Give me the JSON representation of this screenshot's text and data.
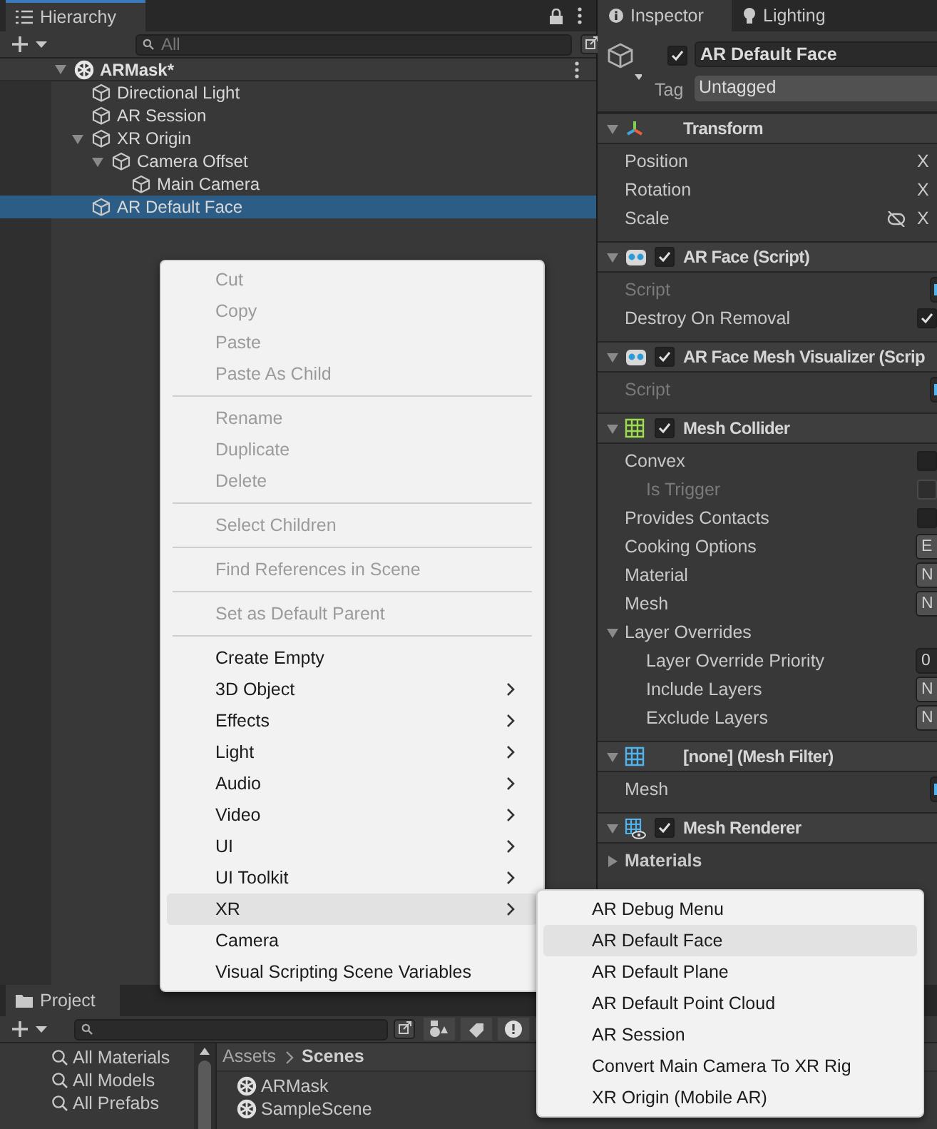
{
  "hierarchy": {
    "tab": "Hierarchy",
    "search_placeholder": "All",
    "scene": {
      "name": "ARMask*",
      "expanded": true,
      "children": [
        {
          "name": "Directional Light",
          "selected": false
        },
        {
          "name": "AR Session",
          "selected": false
        },
        {
          "name": "XR Origin",
          "selected": false,
          "expanded": true,
          "children": [
            {
              "name": "Camera Offset",
              "selected": false,
              "expanded": true,
              "children": [
                {
                  "name": "Main Camera",
                  "selected": false
                }
              ]
            }
          ]
        },
        {
          "name": "AR Default Face",
          "selected": true
        }
      ]
    }
  },
  "context_menu": {
    "groups": [
      [
        {
          "label": "Cut",
          "disabled": true,
          "submenu": false,
          "highlighted": false
        },
        {
          "label": "Copy",
          "disabled": true,
          "submenu": false,
          "highlighted": false
        },
        {
          "label": "Paste",
          "disabled": true,
          "submenu": false,
          "highlighted": false
        },
        {
          "label": "Paste As Child",
          "disabled": true,
          "submenu": false,
          "highlighted": false
        }
      ],
      [
        {
          "label": "Rename",
          "disabled": true,
          "submenu": false,
          "highlighted": false
        },
        {
          "label": "Duplicate",
          "disabled": true,
          "submenu": false,
          "highlighted": false
        },
        {
          "label": "Delete",
          "disabled": true,
          "submenu": false,
          "highlighted": false
        }
      ],
      [
        {
          "label": "Select Children",
          "disabled": true,
          "submenu": false,
          "highlighted": false
        }
      ],
      [
        {
          "label": "Find References in Scene",
          "disabled": true,
          "submenu": false,
          "highlighted": false
        }
      ],
      [
        {
          "label": "Set as Default Parent",
          "disabled": true,
          "submenu": false,
          "highlighted": false
        }
      ],
      [
        {
          "label": "Create Empty",
          "disabled": false,
          "submenu": false,
          "highlighted": false
        },
        {
          "label": "3D Object",
          "disabled": false,
          "submenu": true,
          "highlighted": false
        },
        {
          "label": "Effects",
          "disabled": false,
          "submenu": true,
          "highlighted": false
        },
        {
          "label": "Light",
          "disabled": false,
          "submenu": true,
          "highlighted": false
        },
        {
          "label": "Audio",
          "disabled": false,
          "submenu": true,
          "highlighted": false
        },
        {
          "label": "Video",
          "disabled": false,
          "submenu": true,
          "highlighted": false
        },
        {
          "label": "UI",
          "disabled": false,
          "submenu": true,
          "highlighted": false
        },
        {
          "label": "UI Toolkit",
          "disabled": false,
          "submenu": true,
          "highlighted": false
        },
        {
          "label": "XR",
          "disabled": false,
          "submenu": true,
          "highlighted": true
        },
        {
          "label": "Camera",
          "disabled": false,
          "submenu": false,
          "highlighted": false
        },
        {
          "label": "Visual Scripting Scene Variables",
          "disabled": false,
          "submenu": false,
          "highlighted": false
        }
      ]
    ]
  },
  "submenu": [
    {
      "label": "AR Debug Menu",
      "highlighted": false
    },
    {
      "label": "AR Default Face",
      "highlighted": true
    },
    {
      "label": "AR Default Plane",
      "highlighted": false
    },
    {
      "label": "AR Default Point Cloud",
      "highlighted": false
    },
    {
      "label": "AR Session",
      "highlighted": false
    },
    {
      "label": "Convert Main Camera To XR Rig",
      "highlighted": false
    },
    {
      "label": "XR Origin (Mobile AR)",
      "highlighted": false
    }
  ],
  "inspector": {
    "tabs": [
      {
        "label": "Inspector",
        "selected": true
      },
      {
        "label": "Lighting",
        "selected": false
      }
    ],
    "object": {
      "active": true,
      "name": "AR Default Face",
      "tag_label": "Tag",
      "tag": "Untagged"
    },
    "components": [
      {
        "title": "Transform",
        "kind": "transform",
        "expanded": true,
        "rows": [
          {
            "label": "Position",
            "kind": "axis",
            "value": "X"
          },
          {
            "label": "Rotation",
            "kind": "axis",
            "value": "X"
          },
          {
            "label": "Scale",
            "kind": "axis",
            "value": "X",
            "linked": false
          }
        ]
      },
      {
        "title": "AR Face (Script)",
        "kind": "script",
        "enabled": true,
        "expanded": true,
        "rows": [
          {
            "label": "Script",
            "kind": "object",
            "disabled": true
          },
          {
            "label": "Destroy On Removal",
            "kind": "checkbox",
            "checked": true
          }
        ]
      },
      {
        "title": "AR Face Mesh Visualizer (Scrip",
        "kind": "script",
        "enabled": true,
        "expanded": true,
        "rows": [
          {
            "label": "Script",
            "kind": "object",
            "disabled": true
          }
        ]
      },
      {
        "title": "Mesh Collider",
        "kind": "collider",
        "enabled": true,
        "expanded": true,
        "rows": [
          {
            "label": "Convex",
            "kind": "checkbox",
            "checked": false,
            "children": [
              {
                "label": "Is Trigger",
                "kind": "checkbox",
                "checked": false,
                "disabled": true
              }
            ]
          },
          {
            "label": "Provides Contacts",
            "kind": "checkbox",
            "checked": false
          },
          {
            "label": "Cooking Options",
            "kind": "field",
            "value": "E"
          },
          {
            "label": "Material",
            "kind": "field",
            "value": "N"
          },
          {
            "label": "Mesh",
            "kind": "field",
            "value": "N"
          },
          {
            "label": "Layer Overrides",
            "kind": "foldout",
            "expanded": true,
            "children": [
              {
                "label": "Layer Override Priority",
                "kind": "field",
                "value": "0"
              },
              {
                "label": "Include Layers",
                "kind": "field",
                "value": "N"
              },
              {
                "label": "Exclude Layers",
                "kind": "field",
                "value": "N"
              }
            ]
          }
        ]
      },
      {
        "title": "[none] (Mesh Filter)",
        "kind": "filter",
        "expanded": true,
        "rows": [
          {
            "label": "Mesh",
            "kind": "object"
          }
        ]
      },
      {
        "title": "Mesh Renderer",
        "kind": "renderer",
        "enabled": true,
        "expanded": true,
        "rows": [
          {
            "label": "Materials",
            "kind": "foldout",
            "expanded": false
          }
        ]
      }
    ]
  },
  "project": {
    "tab": "Project",
    "favorites": [
      "All Materials",
      "All Models",
      "All Prefabs"
    ],
    "breadcrumb": [
      "Assets",
      "Scenes"
    ],
    "files": [
      "ARMask",
      "SampleScene"
    ]
  }
}
